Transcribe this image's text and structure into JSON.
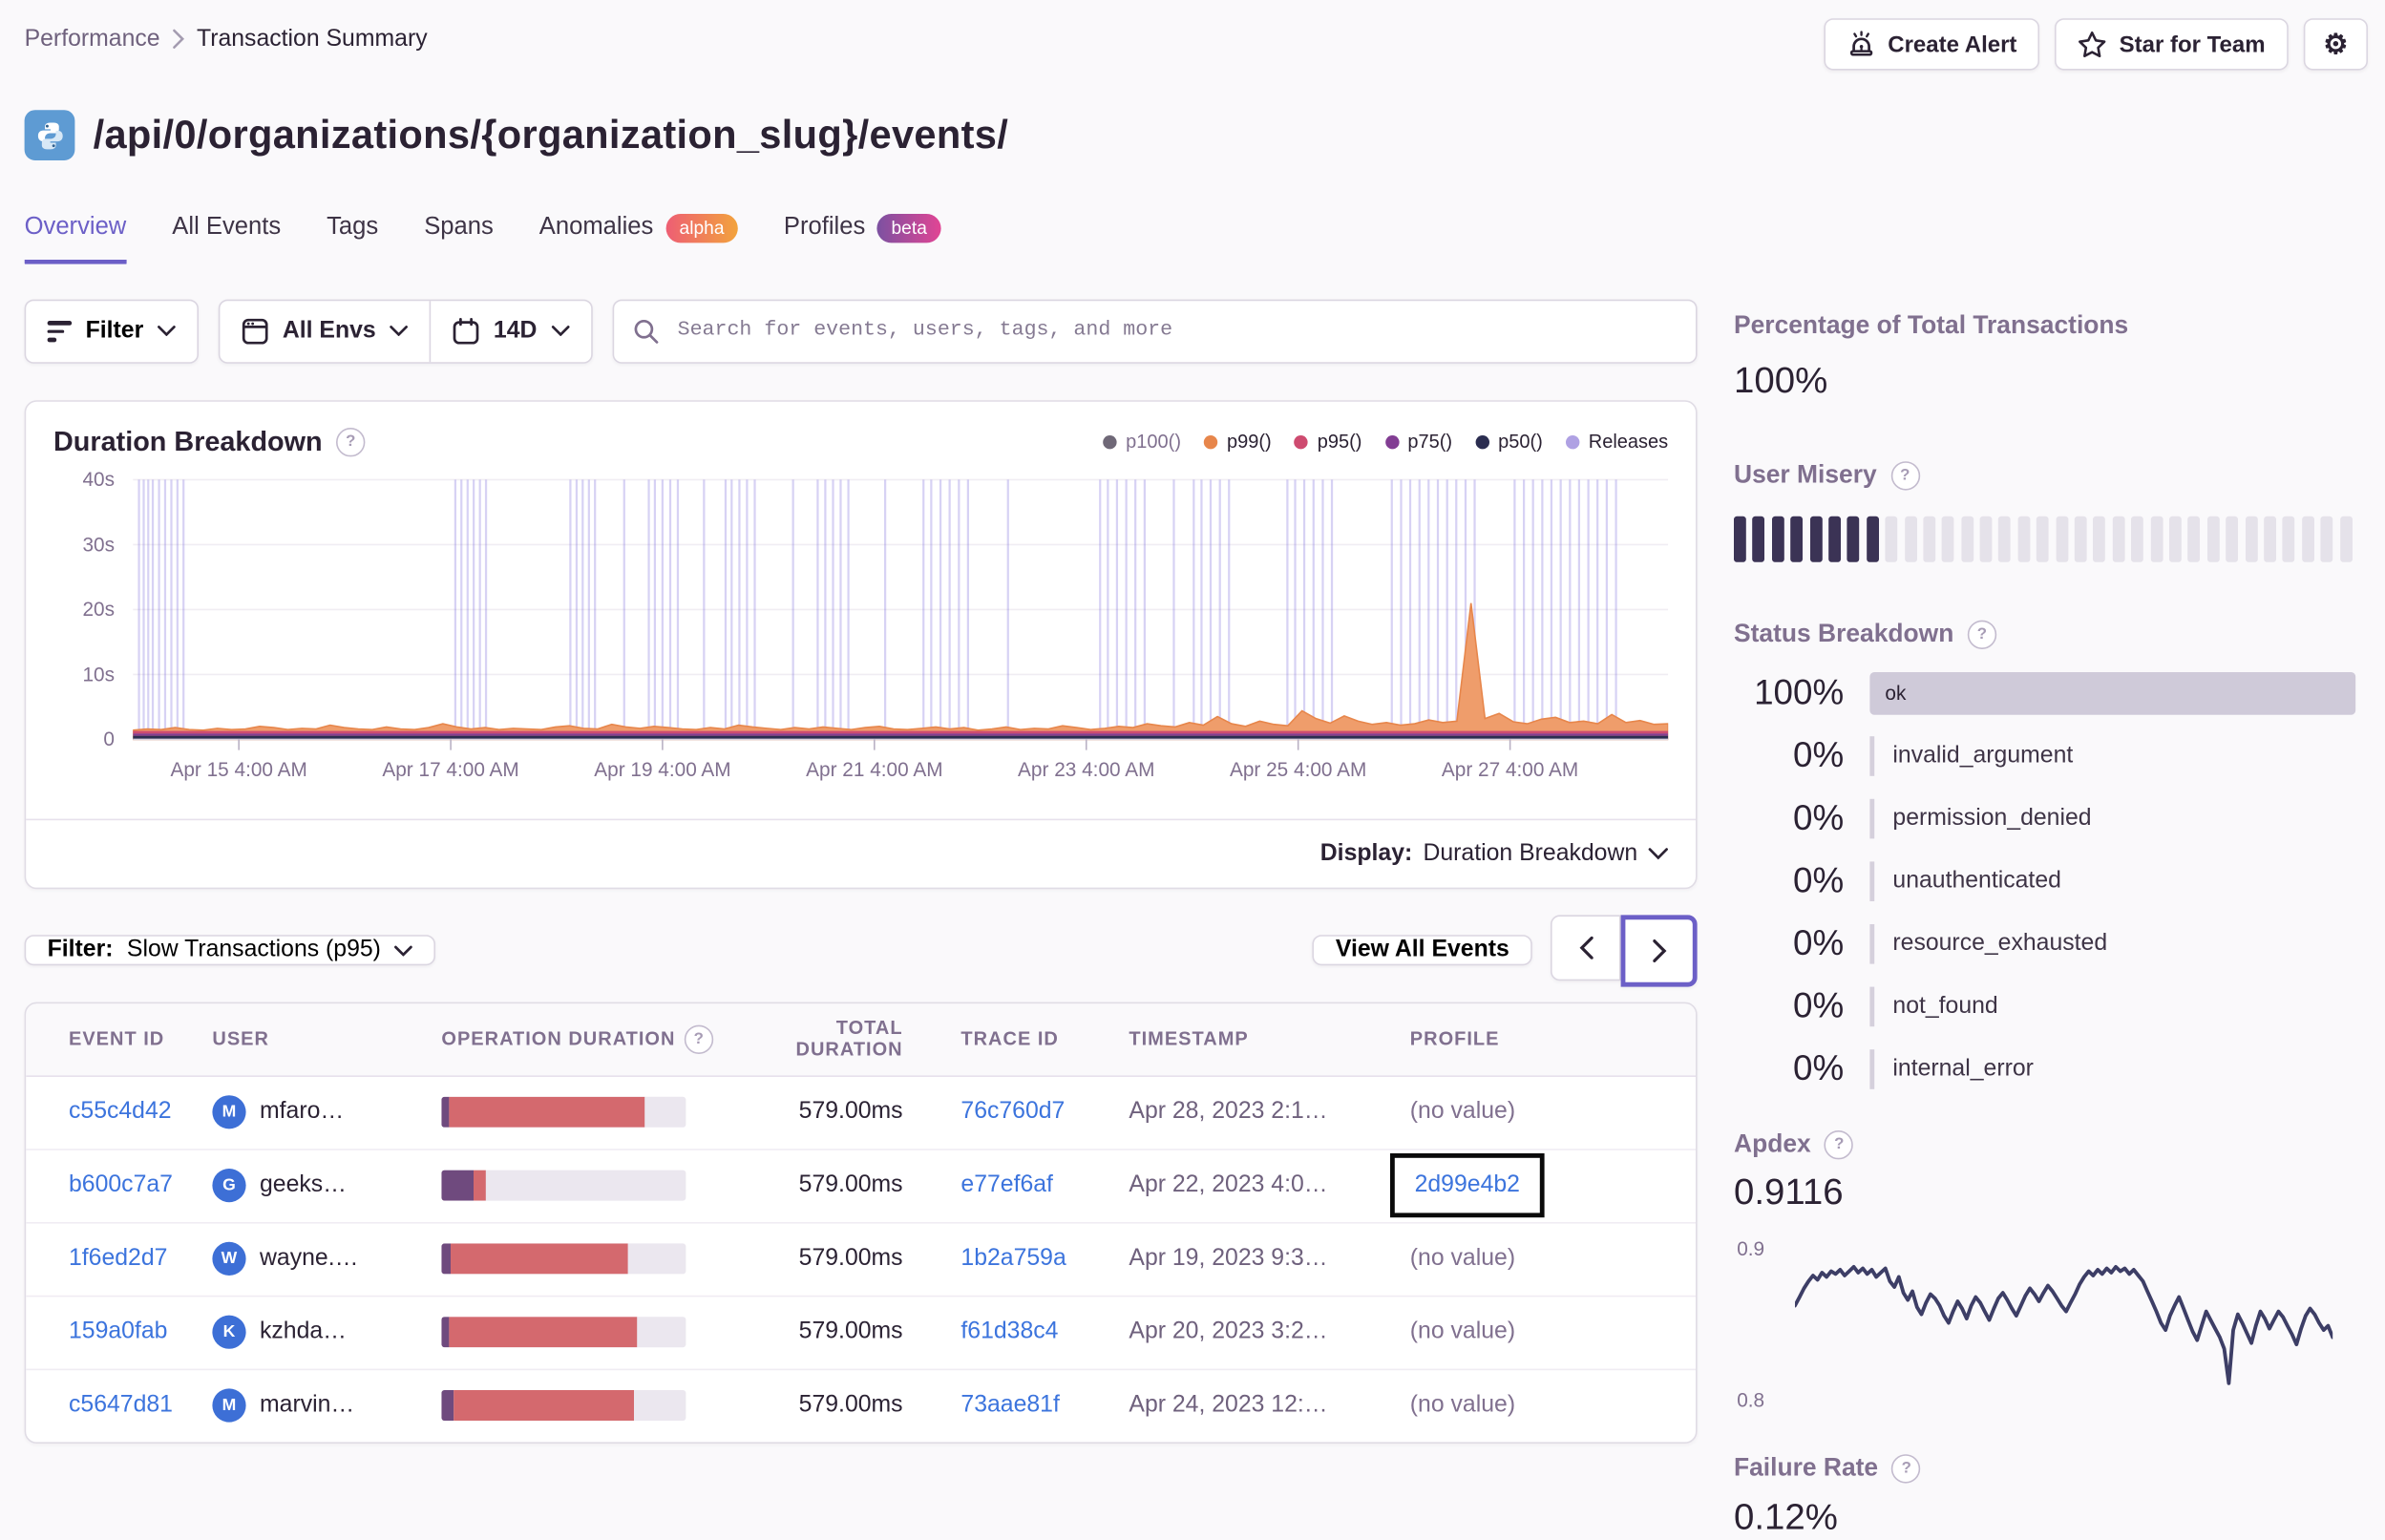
{
  "breadcrumb": {
    "parent": "Performance",
    "current": "Transaction Summary"
  },
  "header": {
    "create_alert_label": "Create Alert",
    "star_label": "Star for Team"
  },
  "page_title": "/api/0/organizations/{organization_slug}/events/",
  "tabs": {
    "overview": "Overview",
    "all_events": "All Events",
    "tags": "Tags",
    "spans": "Spans",
    "anomalies": "Anomalies",
    "anomalies_badge": "alpha",
    "profiles": "Profiles",
    "profiles_badge": "beta"
  },
  "filter_bar": {
    "filter_label": "Filter",
    "env_label": "All Envs",
    "date_label": "14D",
    "search_placeholder": "Search for events, users, tags, and more"
  },
  "duration_panel": {
    "title": "Duration Breakdown",
    "legend": [
      {
        "label": "p100()",
        "color": "#6F6877"
      },
      {
        "label": "p99()",
        "color": "#E7864B"
      },
      {
        "label": "p95()",
        "color": "#CE4B70"
      },
      {
        "label": "p75()",
        "color": "#823D93"
      },
      {
        "label": "p50()",
        "color": "#2B2D50"
      },
      {
        "label": "Releases",
        "color": "#AFA1E3"
      }
    ],
    "display_label": "Display:",
    "display_value": "Duration Breakdown"
  },
  "events_section": {
    "filter_prefix": "Filter:",
    "filter_value": "Slow Transactions (p95)",
    "view_all_label": "View All Events"
  },
  "table": {
    "columns": [
      "Event ID",
      "User",
      "Operation Duration",
      "Total Duration",
      "Trace ID",
      "Timestamp",
      "Profile"
    ],
    "rows": [
      {
        "event_id": "c55c4d42",
        "avatar": "M",
        "user": "mfaro…",
        "op_duration": {
          "purple_pct": 3,
          "red_pct": 80
        },
        "total": "579.00ms",
        "trace": "76c760d7",
        "timestamp": "Apr 28, 2023 2:1…",
        "profile": "(no value)",
        "profile_is_link": false,
        "highlighted": false
      },
      {
        "event_id": "b600c7a7",
        "avatar": "G",
        "user": "geeks…",
        "op_duration": {
          "purple_pct": 13,
          "red_pct": 5
        },
        "total": "579.00ms",
        "trace": "e77ef6af",
        "timestamp": "Apr 22, 2023 4:0…",
        "profile": "2d99e4b2",
        "profile_is_link": true,
        "highlighted": true
      },
      {
        "event_id": "1f6ed2d7",
        "avatar": "W",
        "user": "wayne.…",
        "op_duration": {
          "purple_pct": 4,
          "red_pct": 72
        },
        "total": "579.00ms",
        "trace": "1b2a759a",
        "timestamp": "Apr 19, 2023 9:3…",
        "profile": "(no value)",
        "profile_is_link": false,
        "highlighted": false
      },
      {
        "event_id": "159a0fab",
        "avatar": "K",
        "user": "kzhda…",
        "op_duration": {
          "purple_pct": 3,
          "red_pct": 77
        },
        "total": "579.00ms",
        "trace": "f61d38c4",
        "timestamp": "Apr 20, 2023 3:2…",
        "profile": "(no value)",
        "profile_is_link": false,
        "highlighted": false
      },
      {
        "event_id": "c5647d81",
        "avatar": "M",
        "user": "marvin…",
        "op_duration": {
          "purple_pct": 5,
          "red_pct": 74
        },
        "total": "579.00ms",
        "trace": "73aae81f",
        "timestamp": "Apr 24, 2023 12:…",
        "profile": "(no value)",
        "profile_is_link": false,
        "highlighted": false
      }
    ]
  },
  "sidebar": {
    "pct_total": {
      "title": "Percentage of Total Transactions",
      "value": "100%"
    },
    "user_misery": {
      "title": "User Misery",
      "total_bars": 33,
      "filled_bars": 8
    },
    "status_breakdown": {
      "title": "Status Breakdown",
      "rows": [
        {
          "pct": "100%",
          "label": "ok",
          "full_bar": true
        },
        {
          "pct": "0%",
          "label": "invalid_argument",
          "full_bar": false
        },
        {
          "pct": "0%",
          "label": "permission_denied",
          "full_bar": false
        },
        {
          "pct": "0%",
          "label": "unauthenticated",
          "full_bar": false
        },
        {
          "pct": "0%",
          "label": "resource_exhausted",
          "full_bar": false
        },
        {
          "pct": "0%",
          "label": "not_found",
          "full_bar": false
        },
        {
          "pct": "0%",
          "label": "internal_error",
          "full_bar": false
        }
      ]
    },
    "apdex": {
      "title": "Apdex",
      "value": "0.9116",
      "y_top": "0.9",
      "y_bottom": "0.8"
    },
    "failure_rate": {
      "title": "Failure Rate",
      "value": "0.12%"
    }
  },
  "chart_data": [
    {
      "id": "duration_breakdown",
      "type": "area",
      "title": "Duration Breakdown",
      "ylim": [
        0,
        40
      ],
      "y_ticks": [
        {
          "v": 40,
          "label": "40s"
        },
        {
          "v": 30,
          "label": "30s"
        },
        {
          "v": 20,
          "label": "20s"
        },
        {
          "v": 10,
          "label": "10s"
        },
        {
          "v": 0,
          "label": "0"
        }
      ],
      "x_labels": [
        "Apr 15 4:00 AM",
        "Apr 17 4:00 AM",
        "Apr 19 4:00 AM",
        "Apr 21 4:00 AM",
        "Apr 23 4:00 AM",
        "Apr 25 4:00 AM",
        "Apr 27 4:00 AM"
      ],
      "x_tick_fractions": [
        0.069,
        0.207,
        0.345,
        0.483,
        0.621,
        0.759,
        0.897
      ],
      "series": [
        {
          "name": "p99()",
          "kind": "area",
          "stroke": "#E7864B",
          "fill": "#EF9D6B",
          "values": [
            1.4,
            1.6,
            1.5,
            1.8,
            1.5,
            1.4,
            1.7,
            1.5,
            1.6,
            2.0,
            1.8,
            1.5,
            1.7,
            1.6,
            2.2,
            1.8,
            1.6,
            1.5,
            1.9,
            1.6,
            1.5,
            1.8,
            2.4,
            1.9,
            1.6,
            1.8,
            1.5,
            1.7,
            1.6,
            1.5,
            1.9,
            2.1,
            1.7,
            1.6,
            2.3,
            1.9,
            1.7,
            2.0,
            1.8,
            1.6,
            1.5,
            1.8,
            1.6,
            2.2,
            1.9,
            1.7,
            1.5,
            1.8,
            1.6,
            1.9,
            1.7,
            1.5,
            1.8,
            2.0,
            1.6,
            1.5,
            1.7,
            1.9,
            1.6,
            1.8,
            1.4,
            1.6,
            1.9,
            1.5,
            1.7,
            1.6,
            2.1,
            1.8,
            1.5,
            1.7,
            2.0,
            1.8,
            2.4,
            2.1,
            1.9,
            2.6,
            2.2,
            3.5,
            2.4,
            2.0,
            2.8,
            2.3,
            2.1,
            4.4,
            3.2,
            2.5,
            3.6,
            2.8,
            2.3,
            2.6,
            2.2,
            2.4,
            3.0,
            2.6,
            2.8,
            21.0,
            3.2,
            4.0,
            2.7,
            2.4,
            3.1,
            3.4,
            2.6,
            2.8,
            2.4,
            3.8,
            2.6,
            2.9,
            2.3,
            2.4
          ]
        },
        {
          "name": "p95()",
          "kind": "band",
          "color": "#CE4B70",
          "band": [
            0.9,
            1.3
          ]
        },
        {
          "name": "p75()",
          "kind": "band",
          "color": "#823D93",
          "band": [
            0.55,
            0.9
          ]
        },
        {
          "name": "p50()",
          "kind": "band",
          "color": "#2B2D50",
          "band": [
            0,
            0.55
          ]
        }
      ],
      "releases": {
        "color": "rgba(122,106,220,0.30)",
        "positions": [
          0.004,
          0.007,
          0.01,
          0.013,
          0.017,
          0.021,
          0.025,
          0.029,
          0.033,
          0.21,
          0.214,
          0.218,
          0.222,
          0.226,
          0.23,
          0.285,
          0.289,
          0.293,
          0.297,
          0.301,
          0.32,
          0.336,
          0.34,
          0.345,
          0.35,
          0.355,
          0.372,
          0.386,
          0.39,
          0.395,
          0.4,
          0.405,
          0.43,
          0.446,
          0.451,
          0.456,
          0.461,
          0.466,
          0.49,
          0.515,
          0.52,
          0.526,
          0.532,
          0.538,
          0.544,
          0.57,
          0.63,
          0.635,
          0.641,
          0.647,
          0.653,
          0.659,
          0.678,
          0.691,
          0.696,
          0.702,
          0.708,
          0.714,
          0.752,
          0.757,
          0.763,
          0.769,
          0.775,
          0.781,
          0.82,
          0.826,
          0.832,
          0.838,
          0.844,
          0.85,
          0.856,
          0.862,
          0.868,
          0.874,
          0.9,
          0.906,
          0.912,
          0.918,
          0.924,
          0.93,
          0.936,
          0.942,
          0.948,
          0.954,
          0.96,
          0.966
        ]
      }
    },
    {
      "id": "apdex_trend",
      "type": "line",
      "color": "#3D3E66",
      "ylim": [
        0.8,
        0.9
      ],
      "y_ticks": [
        "0.9",
        "0.8"
      ],
      "values": [
        0.862,
        0.868,
        0.874,
        0.879,
        0.883,
        0.88,
        0.885,
        0.882,
        0.886,
        0.884,
        0.887,
        0.883,
        0.886,
        0.889,
        0.885,
        0.888,
        0.884,
        0.887,
        0.882,
        0.885,
        0.888,
        0.879,
        0.875,
        0.882,
        0.871,
        0.866,
        0.872,
        0.861,
        0.856,
        0.864,
        0.87,
        0.867,
        0.862,
        0.855,
        0.85,
        0.858,
        0.865,
        0.86,
        0.853,
        0.862,
        0.868,
        0.864,
        0.858,
        0.852,
        0.86,
        0.867,
        0.871,
        0.866,
        0.86,
        0.855,
        0.862,
        0.869,
        0.874,
        0.87,
        0.865,
        0.871,
        0.876,
        0.872,
        0.867,
        0.862,
        0.858,
        0.864,
        0.87,
        0.877,
        0.882,
        0.886,
        0.883,
        0.887,
        0.884,
        0.888,
        0.885,
        0.889,
        0.886,
        0.888,
        0.884,
        0.887,
        0.883,
        0.879,
        0.872,
        0.865,
        0.858,
        0.85,
        0.845,
        0.855,
        0.862,
        0.868,
        0.86,
        0.852,
        0.844,
        0.838,
        0.848,
        0.858,
        0.852,
        0.846,
        0.84,
        0.832,
        0.808,
        0.845,
        0.856,
        0.85,
        0.843,
        0.836,
        0.848,
        0.858,
        0.853,
        0.846,
        0.852,
        0.858,
        0.854,
        0.848,
        0.842,
        0.835,
        0.846,
        0.855,
        0.86,
        0.856,
        0.85,
        0.845,
        0.848,
        0.84
      ]
    }
  ]
}
